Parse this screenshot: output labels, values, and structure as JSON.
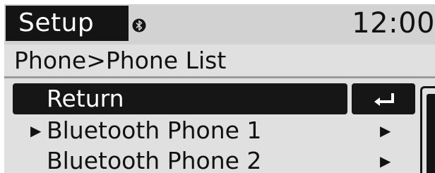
{
  "header": {
    "title": "Setup",
    "clock": "12:00",
    "bluetooth_icon": "bluetooth-icon"
  },
  "breadcrumb": "Phone>Phone List",
  "menu": {
    "items": [
      {
        "label": "Return",
        "selected": true,
        "side_icon": "return-arrow-icon",
        "side_symbol": "↰"
      },
      {
        "label": "Bluetooth Phone 1",
        "selected": false,
        "side_icon": "chevron-right-icon",
        "side_symbol": "▶",
        "marker": "▶"
      },
      {
        "label": "Bluetooth Phone 2",
        "selected": false,
        "side_icon": "chevron-right-icon",
        "side_symbol": "▶"
      }
    ]
  },
  "colors": {
    "dark": "#141414",
    "header_bg": "#d2d2d2",
    "content_bg": "#e0e0e0",
    "highlight_text": "#ffffff"
  }
}
